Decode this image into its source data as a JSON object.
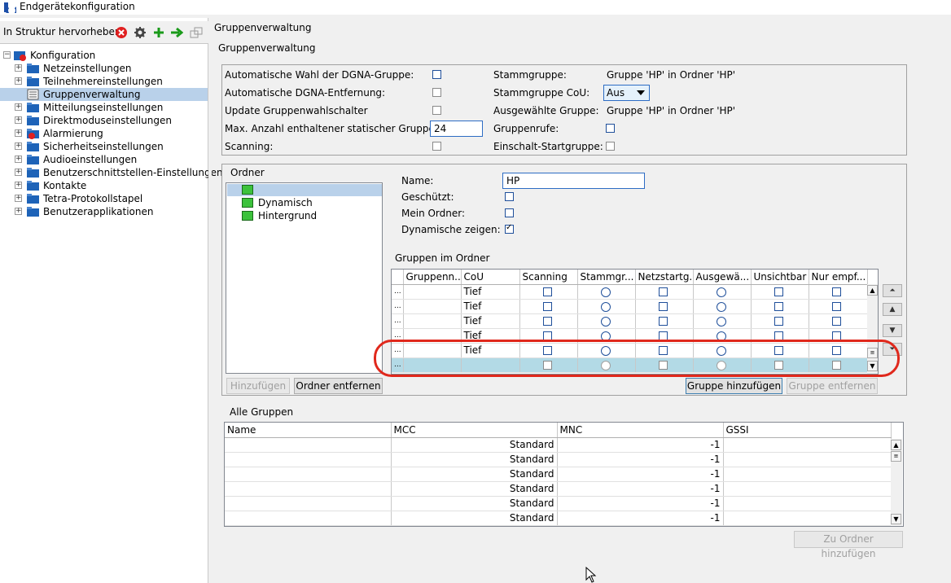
{
  "window": {
    "title": "Endgerätekonfiguration"
  },
  "left": {
    "highlight_label": "In Struktur hervorheben",
    "toolbar_icons": [
      "close-red-icon",
      "gear-icon",
      "plus-green-icon",
      "arrow-right-green-icon",
      "windows-icon"
    ],
    "tree": {
      "root": "Konfiguration",
      "items": [
        {
          "label": "Netzeinstellungen",
          "icon": "folder-icon"
        },
        {
          "label": "Teilnehmereinstellungen",
          "icon": "folder-icon"
        },
        {
          "label": "Gruppenverwaltung",
          "icon": "list-icon",
          "selected": true
        },
        {
          "label": "Mitteilungseinstellungen",
          "icon": "folder-icon"
        },
        {
          "label": "Direktmoduseinstellungen",
          "icon": "folder-icon"
        },
        {
          "label": "Alarmierung",
          "icon": "folder-error-icon"
        },
        {
          "label": "Sicherheitseinstellungen",
          "icon": "folder-icon"
        },
        {
          "label": "Audioeinstellungen",
          "icon": "folder-icon"
        },
        {
          "label": "Benutzerschnittstellen-Einstellungen",
          "icon": "folder-icon"
        },
        {
          "label": "Kontakte",
          "icon": "folder-icon"
        },
        {
          "label": "Tetra-Protokollstapel",
          "icon": "folder-icon"
        },
        {
          "label": "Benutzerapplikationen",
          "icon": "folder-icon"
        }
      ]
    }
  },
  "main": {
    "breadcrumb": "Gruppenverwaltung",
    "section_title": "Gruppenverwaltung",
    "settings": {
      "auto_dgna_label": "Automatische Wahl der DGNA-Gruppe:",
      "auto_dgna_removal_label": "Automatische DGNA-Entfernung:",
      "update_switch_label": "Update Gruppenwahlschalter",
      "max_groups_label": "Max. Anzahl enthaltener statischer Gruppen:",
      "max_groups_value": "24",
      "scanning_label": "Scanning:",
      "stammgruppe_label": "Stammgruppe:",
      "stammgruppe_value": "Gruppe 'HP' in Ordner 'HP'",
      "stammgruppe_cou_label": "Stammgruppe CoU:",
      "stammgruppe_cou_value": "Aus",
      "selected_group_label": "Ausgewählte Gruppe:",
      "selected_group_value": "Gruppe 'HP' in Ordner 'HP'",
      "group_calls_label": "Gruppenrufe:",
      "startup_group_label": "Einschalt-Startgruppe:"
    },
    "folder": {
      "title": "Ordner",
      "tree_items": [
        "",
        "Dynamisch",
        "Hintergrund"
      ],
      "name_label": "Name:",
      "name_value": "HP",
      "protected_label": "Geschützt:",
      "my_folder_label": "Mein Ordner:",
      "show_dynamic_label": "Dynamische zeigen:",
      "groups_in_folder_title": "Gruppen im Ordner",
      "columns": [
        "Gruppenn...",
        "CoU",
        "Scanning",
        "Stammgr...",
        "Netzstartg...",
        "Ausgewä...",
        "Unsichtbar",
        "Nur empf..."
      ],
      "rows": [
        {
          "lead": "...",
          "cou": "Tief"
        },
        {
          "lead": "...",
          "cou": "Tief"
        },
        {
          "lead": "...",
          "cou": "Tief"
        },
        {
          "lead": "...",
          "cou": "Tief"
        },
        {
          "lead": "...",
          "cou": "Tief"
        },
        {
          "lead": "...",
          "cou": ""
        }
      ],
      "add_button": "Hinzufügen",
      "remove_folder_button": "Ordner entfernen",
      "add_group_button": "Gruppe hinzufügen",
      "remove_group_button": "Gruppe entfernen"
    },
    "all_groups": {
      "title": "Alle Gruppen",
      "columns": [
        "Name",
        "MCC",
        "MNC",
        "GSSI"
      ],
      "rows": [
        {
          "mcc": "Standard",
          "mnc": "-1"
        },
        {
          "mcc": "Standard",
          "mnc": "-1"
        },
        {
          "mcc": "Standard",
          "mnc": "-1"
        },
        {
          "mcc": "Standard",
          "mnc": "-1"
        },
        {
          "mcc": "Standard",
          "mnc": "-1"
        },
        {
          "mcc": "Standard",
          "mnc": "-1"
        }
      ],
      "add_to_folder_button": "Zu Ordner hinzufügen"
    }
  },
  "colors": {
    "selection": "#b9d1ea",
    "annotation_red": "#e0281c",
    "folder_blue": "#1e63b8",
    "folder_green": "#3cc23c"
  }
}
